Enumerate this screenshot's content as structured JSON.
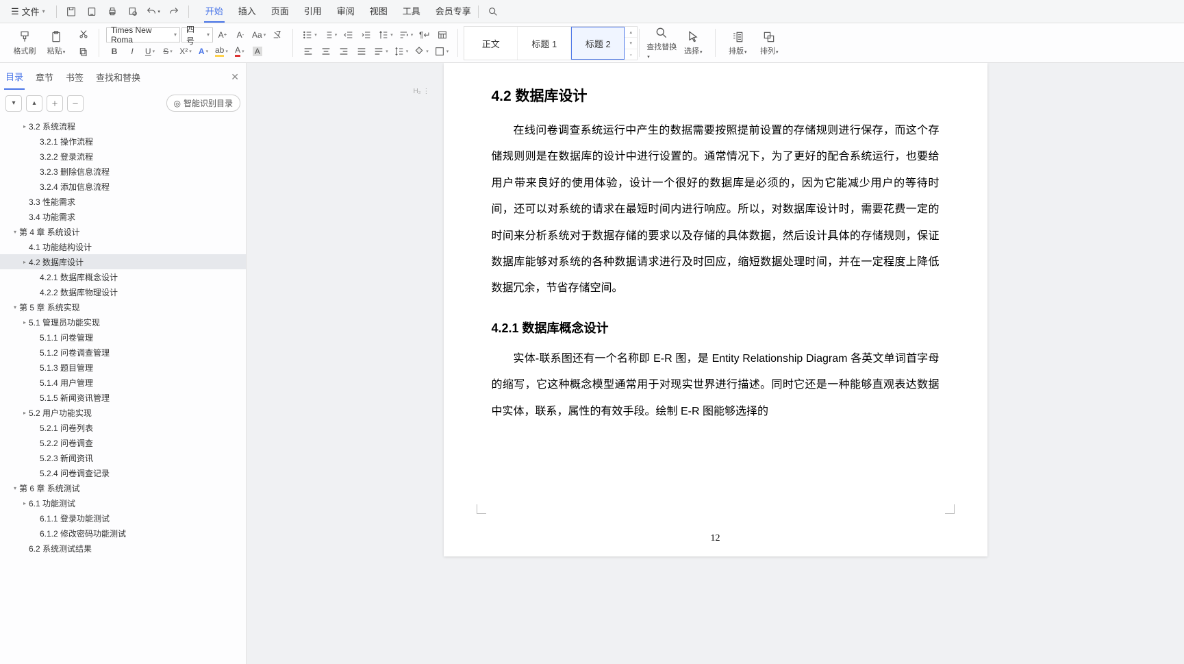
{
  "menubar": {
    "file": "文件",
    "tabs": [
      "开始",
      "插入",
      "页面",
      "引用",
      "审阅",
      "视图",
      "工具",
      "会员专享"
    ],
    "active_tab": 0
  },
  "ribbon": {
    "brush": "格式刷",
    "paste": "粘贴",
    "font_name": "Times New Roma",
    "font_size": "四号",
    "find_replace": "查找替换",
    "select": "选择",
    "typeset": "排版",
    "arrange": "排列",
    "styles": [
      "正文",
      "标题 1",
      "标题 2"
    ],
    "style_selected": 2
  },
  "sidebar": {
    "tabs": [
      "目录",
      "章节",
      "书签",
      "查找和替换"
    ],
    "active": 0,
    "smart_btn": "智能识别目录",
    "outline": [
      {
        "lvl": 2,
        "tw": "▸",
        "label": "3.2  系统流程"
      },
      {
        "lvl": 3,
        "tw": "",
        "label": "3.2.1  操作流程"
      },
      {
        "lvl": 3,
        "tw": "",
        "label": "3.2.2  登录流程"
      },
      {
        "lvl": 3,
        "tw": "",
        "label": "3.2.3  删除信息流程"
      },
      {
        "lvl": 3,
        "tw": "",
        "label": "3.2.4  添加信息流程"
      },
      {
        "lvl": 2,
        "tw": "",
        "label": "3.3  性能需求"
      },
      {
        "lvl": 2,
        "tw": "",
        "label": "3.4  功能需求"
      },
      {
        "lvl": 1,
        "tw": "▾",
        "label": "第 4 章  系统设计"
      },
      {
        "lvl": 2,
        "tw": "",
        "label": "4.1  功能结构设计"
      },
      {
        "lvl": 2,
        "tw": "▸",
        "label": "4.2  数据库设计",
        "selected": true
      },
      {
        "lvl": 3,
        "tw": "",
        "label": "4.2.1  数据库概念设计"
      },
      {
        "lvl": 3,
        "tw": "",
        "label": "4.2.2  数据库物理设计"
      },
      {
        "lvl": 1,
        "tw": "▾",
        "label": "第 5 章  系统实现"
      },
      {
        "lvl": 2,
        "tw": "▸",
        "label": "5.1  管理员功能实现"
      },
      {
        "lvl": 3,
        "tw": "",
        "label": "5.1.1  问卷管理"
      },
      {
        "lvl": 3,
        "tw": "",
        "label": "5.1.2  问卷调查管理"
      },
      {
        "lvl": 3,
        "tw": "",
        "label": "5.1.3  题目管理"
      },
      {
        "lvl": 3,
        "tw": "",
        "label": "5.1.4  用户管理"
      },
      {
        "lvl": 3,
        "tw": "",
        "label": "5.1.5  新闻资讯管理"
      },
      {
        "lvl": 2,
        "tw": "▸",
        "label": "5.2  用户功能实现"
      },
      {
        "lvl": 3,
        "tw": "",
        "label": "5.2.1  问卷列表"
      },
      {
        "lvl": 3,
        "tw": "",
        "label": "5.2.2  问卷调查"
      },
      {
        "lvl": 3,
        "tw": "",
        "label": "5.2.3  新闻资讯"
      },
      {
        "lvl": 3,
        "tw": "",
        "label": "5.2.4  问卷调查记录"
      },
      {
        "lvl": 1,
        "tw": "▾",
        "label": "第 6 章  系统测试"
      },
      {
        "lvl": 2,
        "tw": "▸",
        "label": "6.1  功能测试"
      },
      {
        "lvl": 3,
        "tw": "",
        "label": "6.1.1  登录功能测试"
      },
      {
        "lvl": 3,
        "tw": "",
        "label": "6.1.2  修改密码功能测试"
      },
      {
        "lvl": 2,
        "tw": "",
        "label": "6.2  系统测试结果"
      }
    ]
  },
  "doc": {
    "h2": "4.2  数据库设计",
    "p1": "在线问卷调查系统运行中产生的数据需要按照提前设置的存储规则进行保存，而这个存储规则则是在数据库的设计中进行设置的。通常情况下，为了更好的配合系统运行，也要给用户带来良好的使用体验，设计一个很好的数据库是必须的，因为它能减少用户的等待时间，还可以对系统的请求在最短时间内进行响应。所以，对数据库设计时，需要花费一定的时间来分析系统对于数据存储的要求以及存储的具体数据，然后设计具体的存储规则，保证数据库能够对系统的各种数据请求进行及时回应，缩短数据处理时间，并在一定程度上降低数据冗余，节省存储空间。",
    "h3": "4.2.1  数据库概念设计",
    "p2": "实体-联系图还有一个名称即 E-R 图，是 Entity Relationship Diagram 各英文单词首字母的缩写，它这种概念模型通常用于对现实世界进行描述。同时它还是一种能够直观表达数据中实体，联系，属性的有效手段。绘制 E-R 图能够选择的",
    "page_num": "12",
    "margin_marker": "H₂  ⋮"
  }
}
